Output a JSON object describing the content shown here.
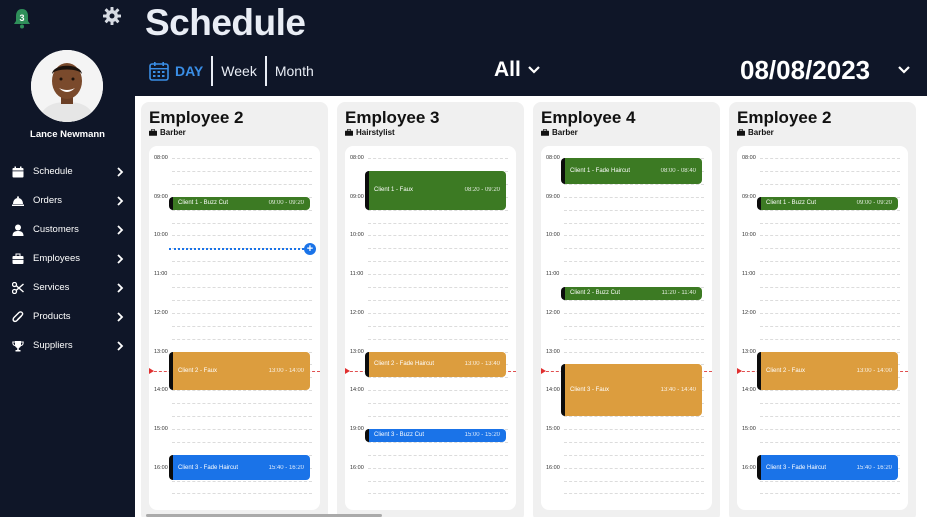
{
  "sidebar": {
    "notification_count": "3",
    "user_name": "Lance Newmann",
    "nav": [
      {
        "label": "Schedule",
        "icon": "calendar-icon"
      },
      {
        "label": "Orders",
        "icon": "cloche-icon"
      },
      {
        "label": "Customers",
        "icon": "user-icon"
      },
      {
        "label": "Employees",
        "icon": "briefcase-icon"
      },
      {
        "label": "Services",
        "icon": "scissors-icon"
      },
      {
        "label": "Products",
        "icon": "paperclip-icon"
      },
      {
        "label": "Suppliers",
        "icon": "trophy-icon"
      }
    ]
  },
  "header": {
    "title": "Schedule",
    "views": [
      "DAY",
      "Week",
      "Month"
    ],
    "active_view": "DAY",
    "filter": "All",
    "date": "08/08/2023"
  },
  "colors": {
    "dark": "#0f1628",
    "accent": "#3a8ee6",
    "green": "#3c7a23",
    "orange": "#dc9d3e",
    "blue": "#1a73e8"
  },
  "time_labels": [
    "08:00",
    "09:00",
    "10:00",
    "11:00",
    "12:00",
    "13:00",
    "14:00",
    "15:00",
    "16:00"
  ],
  "columns": [
    {
      "name": "Employee 2",
      "role": "Barber",
      "time_labels": [
        "08:00",
        "09:00",
        "10:00",
        "11:00",
        "12:00",
        "13:00",
        "14:00",
        "15:00",
        "16:00"
      ],
      "appointments": [
        {
          "title": "Client 1 - Buzz Cut",
          "time": "09:00 - 09:20",
          "start": "09:00",
          "end": "09:20",
          "color": "green"
        },
        {
          "title": "Client 2 - Faux",
          "time": "13:00 - 14:00",
          "start": "13:00",
          "end": "14:00",
          "color": "orange"
        },
        {
          "title": "Client 3 - Fade Haircut",
          "time": "15:40 - 16:20",
          "start": "15:40",
          "end": "16:20",
          "color": "blue"
        }
      ],
      "add_slot": "10:20"
    },
    {
      "name": "Employee 3",
      "role": "Hairstylist",
      "time_labels": [
        "08:00",
        "09:00",
        "10:00",
        "11:00",
        "12:00",
        "13:00",
        "14:00",
        "19:00",
        "16:00"
      ],
      "appointments": [
        {
          "title": "Client 1 - Faux",
          "time": "08:20 - 09:20",
          "start": "08:20",
          "end": "09:20",
          "color": "green"
        },
        {
          "title": "Client 2 - Fade Haircut",
          "time": "13:00 - 13:40",
          "start": "13:00",
          "end": "13:40",
          "color": "orange"
        },
        {
          "title": "Client 3 - Buzz Cut",
          "time": "15:00 - 15:20",
          "start": "15:00",
          "end": "15:20",
          "color": "blue"
        }
      ]
    },
    {
      "name": "Employee 4",
      "role": "Barber",
      "time_labels": [
        "08:00",
        "09:00",
        "10:00",
        "11:00",
        "12:00",
        "13:00",
        "14:00",
        "15:00",
        "16:00"
      ],
      "appointments": [
        {
          "title": "Client 1 - Fade Haircut",
          "time": "08:00 - 08:40",
          "start": "08:00",
          "end": "08:40",
          "color": "green"
        },
        {
          "title": "Client 2 - Buzz Cut",
          "time": "11:20 - 11:40",
          "start": "11:20",
          "end": "11:40",
          "color": "green"
        },
        {
          "title": "Client 3 - Faux",
          "time": "13:40 - 14:40",
          "start": "13:20",
          "end": "14:40",
          "color": "orange"
        }
      ]
    },
    {
      "name": "Employee 2",
      "role": "Barber",
      "time_labels": [
        "08:00",
        "09:00",
        "10:00",
        "11:00",
        "12:00",
        "13:00",
        "14:00",
        "15:00",
        "16:00"
      ],
      "appointments": [
        {
          "title": "Client 1 - Buzz Cut",
          "time": "09:00 - 09:20",
          "start": "09:00",
          "end": "09:20",
          "color": "green"
        },
        {
          "title": "Client 2 - Faux",
          "time": "13:00 - 14:00",
          "start": "13:00",
          "end": "14:00",
          "color": "orange"
        },
        {
          "title": "Client 3 - Fade Haircut",
          "time": "15:40 - 16:20",
          "start": "15:40",
          "end": "16:20",
          "color": "blue"
        }
      ]
    }
  ],
  "current_time": "13:30"
}
